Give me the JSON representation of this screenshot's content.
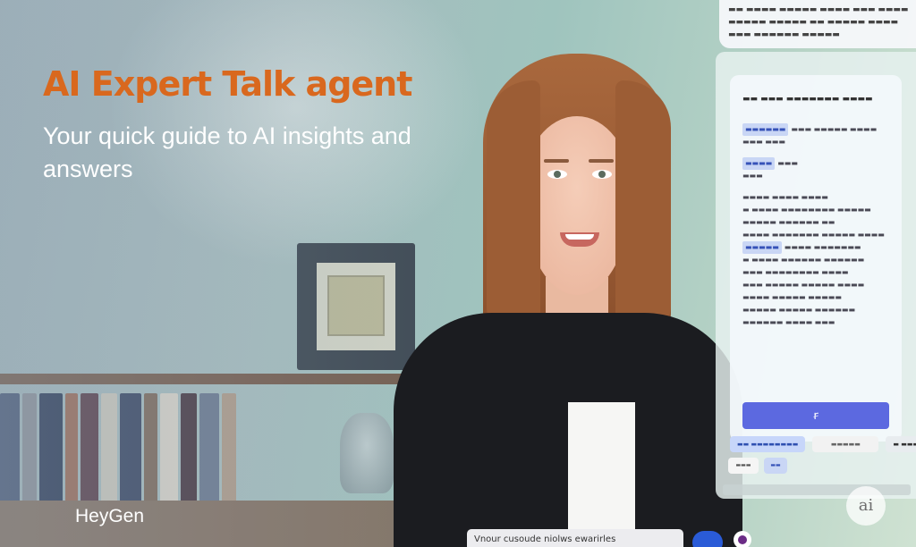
{
  "headline": {
    "title": "AI Expert Talk agent",
    "subtitle": "Your quick guide to AI insights and answers"
  },
  "brand": {
    "name": "HeyGen"
  },
  "colors": {
    "title_accent": "#d9681e",
    "primary_button": "#5c69e0",
    "mic_button": "#2a5bd7"
  },
  "input_bar": {
    "value": "Vnour cusoude niolws ewarirles"
  },
  "buttons": {
    "send_label": "ꞧ"
  }
}
